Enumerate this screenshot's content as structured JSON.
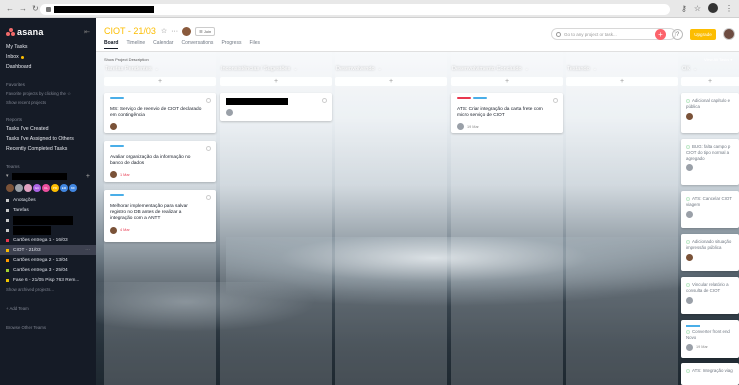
{
  "sidebar": {
    "logo": "asana",
    "nav": [
      "My Tasks",
      "Inbox",
      "Dashboard"
    ],
    "favorites_heading": "Favorites",
    "favorites_hint": "Favorite projects by clicking the ☆",
    "show_recent": "Show recent projects",
    "reports_heading": "Reports",
    "reports": [
      "Tasks I've Created",
      "Tasks I've Assigned to Others",
      "Recently Completed Tasks"
    ],
    "teams_heading": "Teams",
    "team_avatars": [
      "GC",
      "CL",
      "PR",
      "EM",
      "MF"
    ],
    "projects": [
      {
        "label": "Anotações",
        "color": "#c7c7c7"
      },
      {
        "label": "Tarefas",
        "color": "#c7c7c7"
      },
      {
        "label": "Cartões entrega 1 - 16/03",
        "color": "#e8384f"
      },
      {
        "label": "CIOT - 21/03",
        "color": "#fcbd01"
      },
      {
        "label": "Cartões entrega 2 - 13/04",
        "color": "#fd9a00"
      },
      {
        "label": "Cartões entrega 3 - 25/04",
        "color": "#a4cf30"
      },
      {
        "label": "Fase 6 - 21/05 Pisp 763 Rem...",
        "color": "#eec300"
      }
    ],
    "show_archived": "Show archived projects...",
    "add_team": "+ Add Team",
    "browse_teams": "Browse Other Teams"
  },
  "topbar": {
    "title": "CIOT - 21/03",
    "join": "Join",
    "tabs": [
      "Board",
      "Timeline",
      "Calendar",
      "Conversations",
      "Progress",
      "Files"
    ],
    "active_tab": "Board",
    "search_placeholder": "Go to any project or task...",
    "upgrade": "Upgrade"
  },
  "board": {
    "show_description": "Show Project Description",
    "view_all": "View All Tasks",
    "columns": [
      "Tarefas Pendentes",
      "Inconsistências / Sugestões",
      "Desenvolvendo",
      "Desenvolvimento Concluído",
      "Testando",
      "OK"
    ],
    "cards": {
      "c0_0": {
        "name": "MS: Serviço de reenvio de CIOT declarado em contingência"
      },
      "c0_1": {
        "name": "Avaliar organização da informação no banco de dados",
        "due": "1 Mar"
      },
      "c0_2": {
        "name": "Melhorar implementação para salvar registro no DB antes de realizar a integração com a ANTT",
        "due": "4 Mar"
      },
      "c3_0": {
        "name": "ATS: Criar integração da carta frete com micro serviço de CIOT",
        "due": "19 Mar"
      }
    },
    "ok_cards": [
      {
        "l1": "Adicional capítulo e",
        "l2": "pública"
      },
      {
        "l1": "BUG: falta campo p",
        "l2": "CIOT do tipo normal a",
        "l3": "agregado"
      },
      {
        "l1": "ATS: Cancelar CIOT",
        "l2": "viagem"
      },
      {
        "l1": "Adicionado situação",
        "l2": "impressão pública"
      },
      {
        "l1": "Vincular relatório a",
        "l2": "consulta de CIOT"
      },
      {
        "l1": "Converter front end",
        "l2": "Novo",
        "l3": "19 Mar"
      },
      {
        "l1": "ATS: Integração viag"
      }
    ]
  }
}
